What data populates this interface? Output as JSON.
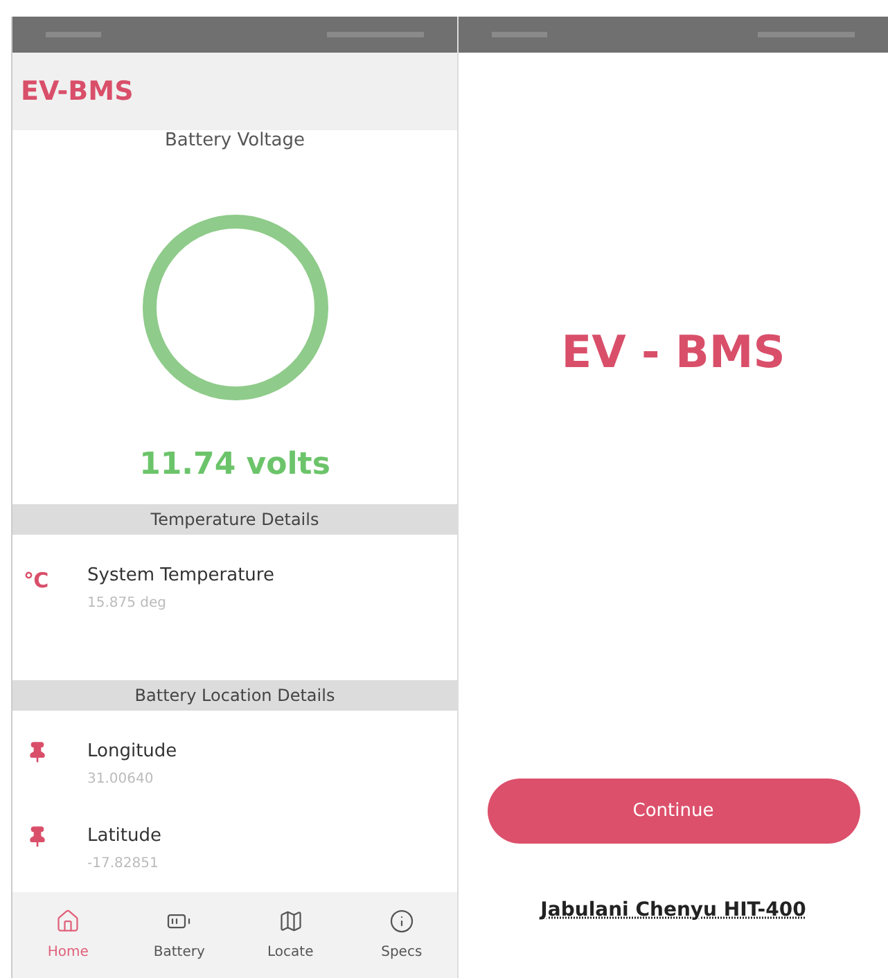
{
  "home_screen": {
    "app_title": "EV-BMS",
    "voltage": {
      "title": "Battery Voltage",
      "reading": "11.74 volts"
    },
    "sections": [
      {
        "title": "Temperature Details",
        "items": [
          {
            "kind": "temperature",
            "icon_text": "℃",
            "label": "System Temperature",
            "value": "15.875 deg"
          }
        ]
      },
      {
        "title": "Battery Location Details",
        "items": [
          {
            "kind": "pin",
            "label": "Longitude",
            "value": "31.00640"
          },
          {
            "kind": "pin",
            "label": "Latitude",
            "value": "-17.82851"
          }
        ]
      }
    ],
    "nav": [
      {
        "kind": "home",
        "label": "Home",
        "selected": true
      },
      {
        "kind": "battery",
        "label": "Battery",
        "selected": false
      },
      {
        "kind": "map",
        "label": "Locate",
        "selected": false
      },
      {
        "kind": "info",
        "label": "Specs",
        "selected": false
      }
    ]
  },
  "splash_screen": {
    "logo": "EV - BMS",
    "button": "Continue",
    "author": "Jabulani Chenyu HIT-400"
  }
}
